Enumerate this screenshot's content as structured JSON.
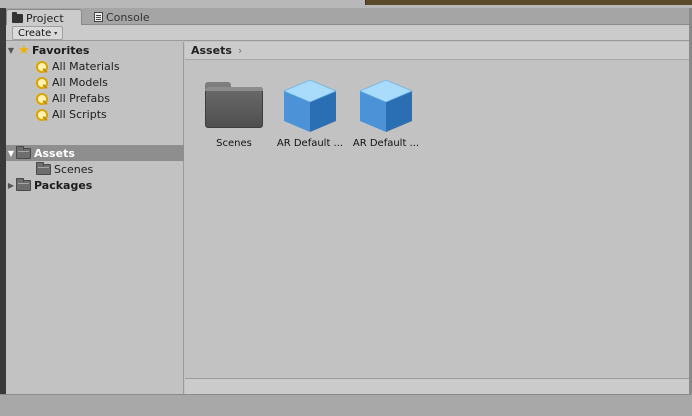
{
  "tabs": [
    {
      "label": "Project",
      "icon": "folder-icon",
      "active": true
    },
    {
      "label": "Console",
      "icon": "console-icon",
      "active": false
    }
  ],
  "toolbar": {
    "create_label": "Create",
    "create_caret": "▾"
  },
  "tree": {
    "favorites": {
      "label": "Favorites",
      "items": [
        "All Materials",
        "All Models",
        "All Prefabs",
        "All Scripts"
      ]
    },
    "assets": {
      "label": "Assets",
      "children": [
        "Scenes"
      ]
    },
    "packages": {
      "label": "Packages"
    }
  },
  "breadcrumb": {
    "items": [
      "Assets"
    ],
    "separator": "›"
  },
  "assets": [
    {
      "label": "Scenes",
      "icon": "folder-icon"
    },
    {
      "label": "AR Default ...",
      "icon": "cube-icon"
    },
    {
      "label": "AR Default ...",
      "icon": "cube-icon"
    }
  ],
  "colors": {
    "selection": "#8e8e8e",
    "cube_light": "#7cc4f5",
    "cube_dark": "#2a6fb3",
    "star": "#f0b400"
  }
}
